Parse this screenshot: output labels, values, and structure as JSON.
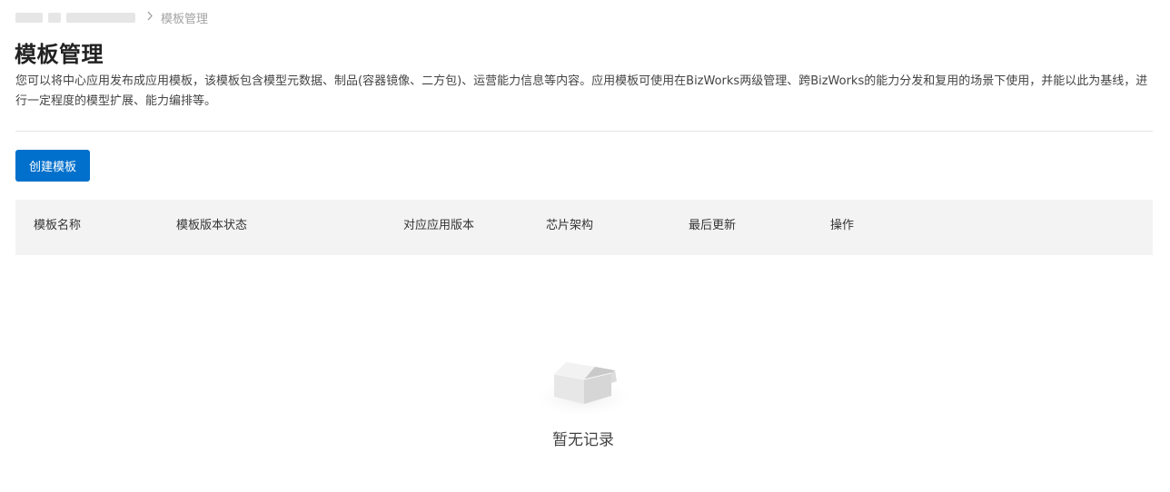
{
  "breadcrumb": {
    "current": "模板管理",
    "separator": ">"
  },
  "page": {
    "title": "模板管理",
    "description": "您可以将中心应用发布成应用模板，该模板包含模型元数据、制品(容器镜像、二方包)、运营能力信息等内容。应用模板可使用在BizWorks两级管理、跨BizWorks的能力分发和复用的场景下使用，并能以此为基线，进行一定程度的模型扩展、能力编排等。"
  },
  "toolbar": {
    "create_label": "创建模板"
  },
  "table": {
    "columns": [
      "模板名称",
      "模板版本状态",
      "对应应用版本",
      "芯片架构",
      "最后更新",
      "操作"
    ],
    "rows": []
  },
  "empty_state": {
    "text": "暂无记录",
    "icon": "empty-box-icon"
  },
  "colors": {
    "primary": "#0070cc",
    "header_bg": "#f3f3f3"
  }
}
